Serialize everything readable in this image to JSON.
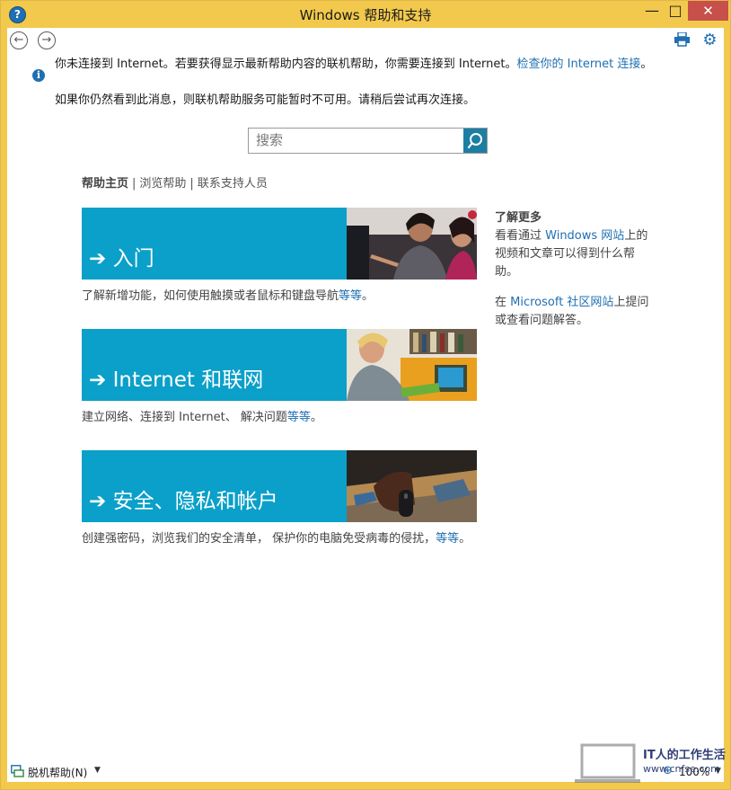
{
  "window": {
    "title": "Windows 帮助和支持"
  },
  "notice": {
    "line1": "你未连接到 Internet。若要获得显示最新帮助内容的联机帮助，你需要连接到 Internet。",
    "line1_link": "检查你的 Internet 连接",
    "line1_end": "。",
    "line2": "如果你仍然看到此消息，则联机帮助服务可能暂时不可用。请稍后尝试再次连接。"
  },
  "search": {
    "placeholder": "搜索"
  },
  "breadcrumb": {
    "home": "帮助主页",
    "sep": "|",
    "browse": "浏览帮助",
    "contact": "联系支持人员"
  },
  "tiles": [
    {
      "label": "入门",
      "desc": "了解新增功能，如何使用触摸或者鼠标和键盘导航",
      "more": "等等",
      "end": "。"
    },
    {
      "label": "Internet 和联网",
      "desc": "建立网络、连接到 Internet、 解决问题",
      "more": "等等",
      "end": "。"
    },
    {
      "label": "安全、隐私和帐户",
      "desc": "创建强密码，浏览我们的安全清单， 保护你的电脑免受病毒的侵扰，",
      "more": "等等",
      "end": "。"
    }
  ],
  "sidebar": {
    "title": "了解更多",
    "p1_before": "看看通过 ",
    "p1_link": "Windows 网站",
    "p1_after": "上的视频和文章可以得到什么帮助。",
    "p2_before": "在 ",
    "p2_link": "Microsoft 社区网站",
    "p2_after": "上提问或查看问题解答。"
  },
  "statusbar": {
    "offline": "脱机帮助(N)",
    "zoom": "100%"
  },
  "watermark": {
    "text": "IT人的工作生活",
    "url": "www.cnfse.com"
  },
  "colors": {
    "accent": "#0aa0c9",
    "link": "#1f6fb2",
    "frame": "#f2c94c",
    "close": "#c7504a"
  }
}
